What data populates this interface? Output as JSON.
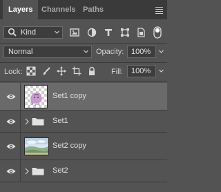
{
  "tabs": [
    {
      "label": "Layers",
      "active": true
    },
    {
      "label": "Channels",
      "active": false
    },
    {
      "label": "Paths",
      "active": false
    }
  ],
  "filter": {
    "kind_label": "Kind",
    "icons": [
      "image-filter-icon",
      "adjustment-filter-icon",
      "type-filter-icon",
      "shape-filter-icon",
      "smart-object-filter-icon",
      "filter-toggle-icon"
    ]
  },
  "blend": {
    "mode": "Normal",
    "opacity_label": "Opacity:",
    "opacity_value": "100%"
  },
  "lock": {
    "lock_label": "Lock:",
    "fill_label": "Fill:",
    "fill_value": "100%"
  },
  "layers": [
    {
      "name": "Set1 copy",
      "type": "layer",
      "selected": true,
      "visible": true
    },
    {
      "name": "Set1",
      "type": "group",
      "selected": false,
      "visible": true
    },
    {
      "name": "Set2 copy",
      "type": "layer",
      "selected": false,
      "visible": true
    },
    {
      "name": "Set2",
      "type": "group",
      "selected": false,
      "visible": true
    }
  ],
  "colors": {
    "panel_bg": "#535353",
    "tabbar_bg": "#3a3a3a",
    "selected_row": "#6a6a6a",
    "text": "#d6d6d6"
  }
}
